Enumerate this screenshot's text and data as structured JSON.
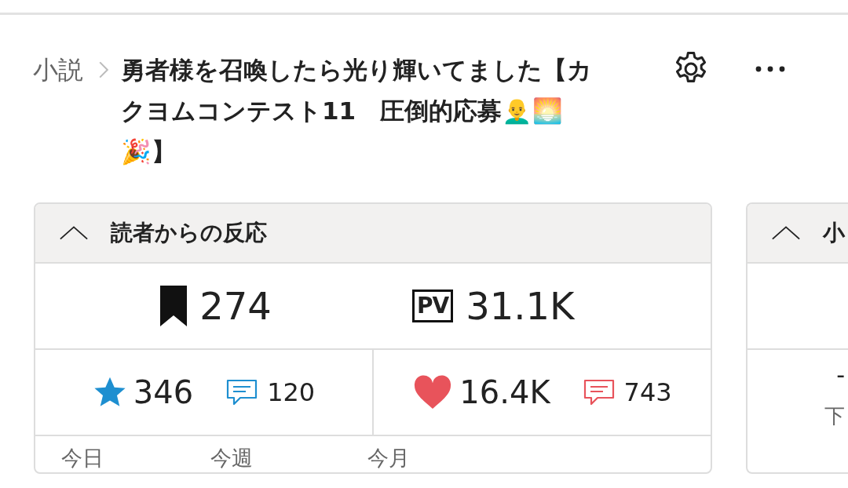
{
  "breadcrumb": {
    "category": "小説",
    "title": "勇者様を召喚したら光り輝いてました【カクヨムコンテスト11　圧倒的応募👨‍🦲🌅🎉】"
  },
  "reactions_card": {
    "title": "読者からの反応",
    "expanded": true,
    "top": [
      {
        "kind": "bookmark",
        "value": "274"
      },
      {
        "kind": "pv",
        "value": "31.1K",
        "badge": "PV"
      }
    ],
    "bottom": [
      {
        "kind": "star",
        "value": "346",
        "comments": "120",
        "color": "#1e8fd0"
      },
      {
        "kind": "heart",
        "value": "16.4K",
        "comments": "743",
        "color": "#e8535b"
      }
    ],
    "periods": [
      "今日",
      "今週",
      "今月"
    ]
  },
  "side_card": {
    "title": "小",
    "expanded": true,
    "row_1": "-",
    "row_2": "下"
  }
}
